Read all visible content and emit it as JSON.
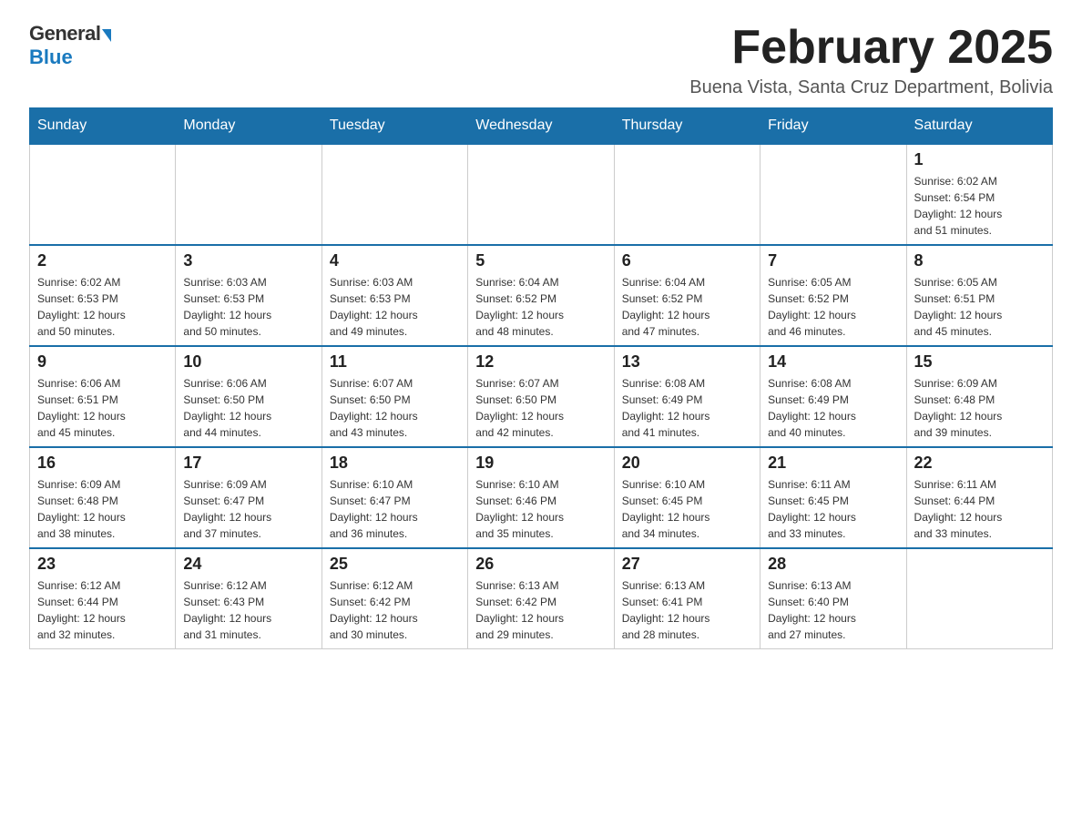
{
  "logo": {
    "general": "General",
    "blue": "Blue"
  },
  "title": "February 2025",
  "subtitle": "Buena Vista, Santa Cruz Department, Bolivia",
  "days_of_week": [
    "Sunday",
    "Monday",
    "Tuesday",
    "Wednesday",
    "Thursday",
    "Friday",
    "Saturday"
  ],
  "weeks": [
    [
      {
        "day": "",
        "info": ""
      },
      {
        "day": "",
        "info": ""
      },
      {
        "day": "",
        "info": ""
      },
      {
        "day": "",
        "info": ""
      },
      {
        "day": "",
        "info": ""
      },
      {
        "day": "",
        "info": ""
      },
      {
        "day": "1",
        "info": "Sunrise: 6:02 AM\nSunset: 6:54 PM\nDaylight: 12 hours\nand 51 minutes."
      }
    ],
    [
      {
        "day": "2",
        "info": "Sunrise: 6:02 AM\nSunset: 6:53 PM\nDaylight: 12 hours\nand 50 minutes."
      },
      {
        "day": "3",
        "info": "Sunrise: 6:03 AM\nSunset: 6:53 PM\nDaylight: 12 hours\nand 50 minutes."
      },
      {
        "day": "4",
        "info": "Sunrise: 6:03 AM\nSunset: 6:53 PM\nDaylight: 12 hours\nand 49 minutes."
      },
      {
        "day": "5",
        "info": "Sunrise: 6:04 AM\nSunset: 6:52 PM\nDaylight: 12 hours\nand 48 minutes."
      },
      {
        "day": "6",
        "info": "Sunrise: 6:04 AM\nSunset: 6:52 PM\nDaylight: 12 hours\nand 47 minutes."
      },
      {
        "day": "7",
        "info": "Sunrise: 6:05 AM\nSunset: 6:52 PM\nDaylight: 12 hours\nand 46 minutes."
      },
      {
        "day": "8",
        "info": "Sunrise: 6:05 AM\nSunset: 6:51 PM\nDaylight: 12 hours\nand 45 minutes."
      }
    ],
    [
      {
        "day": "9",
        "info": "Sunrise: 6:06 AM\nSunset: 6:51 PM\nDaylight: 12 hours\nand 45 minutes."
      },
      {
        "day": "10",
        "info": "Sunrise: 6:06 AM\nSunset: 6:50 PM\nDaylight: 12 hours\nand 44 minutes."
      },
      {
        "day": "11",
        "info": "Sunrise: 6:07 AM\nSunset: 6:50 PM\nDaylight: 12 hours\nand 43 minutes."
      },
      {
        "day": "12",
        "info": "Sunrise: 6:07 AM\nSunset: 6:50 PM\nDaylight: 12 hours\nand 42 minutes."
      },
      {
        "day": "13",
        "info": "Sunrise: 6:08 AM\nSunset: 6:49 PM\nDaylight: 12 hours\nand 41 minutes."
      },
      {
        "day": "14",
        "info": "Sunrise: 6:08 AM\nSunset: 6:49 PM\nDaylight: 12 hours\nand 40 minutes."
      },
      {
        "day": "15",
        "info": "Sunrise: 6:09 AM\nSunset: 6:48 PM\nDaylight: 12 hours\nand 39 minutes."
      }
    ],
    [
      {
        "day": "16",
        "info": "Sunrise: 6:09 AM\nSunset: 6:48 PM\nDaylight: 12 hours\nand 38 minutes."
      },
      {
        "day": "17",
        "info": "Sunrise: 6:09 AM\nSunset: 6:47 PM\nDaylight: 12 hours\nand 37 minutes."
      },
      {
        "day": "18",
        "info": "Sunrise: 6:10 AM\nSunset: 6:47 PM\nDaylight: 12 hours\nand 36 minutes."
      },
      {
        "day": "19",
        "info": "Sunrise: 6:10 AM\nSunset: 6:46 PM\nDaylight: 12 hours\nand 35 minutes."
      },
      {
        "day": "20",
        "info": "Sunrise: 6:10 AM\nSunset: 6:45 PM\nDaylight: 12 hours\nand 34 minutes."
      },
      {
        "day": "21",
        "info": "Sunrise: 6:11 AM\nSunset: 6:45 PM\nDaylight: 12 hours\nand 33 minutes."
      },
      {
        "day": "22",
        "info": "Sunrise: 6:11 AM\nSunset: 6:44 PM\nDaylight: 12 hours\nand 33 minutes."
      }
    ],
    [
      {
        "day": "23",
        "info": "Sunrise: 6:12 AM\nSunset: 6:44 PM\nDaylight: 12 hours\nand 32 minutes."
      },
      {
        "day": "24",
        "info": "Sunrise: 6:12 AM\nSunset: 6:43 PM\nDaylight: 12 hours\nand 31 minutes."
      },
      {
        "day": "25",
        "info": "Sunrise: 6:12 AM\nSunset: 6:42 PM\nDaylight: 12 hours\nand 30 minutes."
      },
      {
        "day": "26",
        "info": "Sunrise: 6:13 AM\nSunset: 6:42 PM\nDaylight: 12 hours\nand 29 minutes."
      },
      {
        "day": "27",
        "info": "Sunrise: 6:13 AM\nSunset: 6:41 PM\nDaylight: 12 hours\nand 28 minutes."
      },
      {
        "day": "28",
        "info": "Sunrise: 6:13 AM\nSunset: 6:40 PM\nDaylight: 12 hours\nand 27 minutes."
      },
      {
        "day": "",
        "info": ""
      }
    ]
  ]
}
